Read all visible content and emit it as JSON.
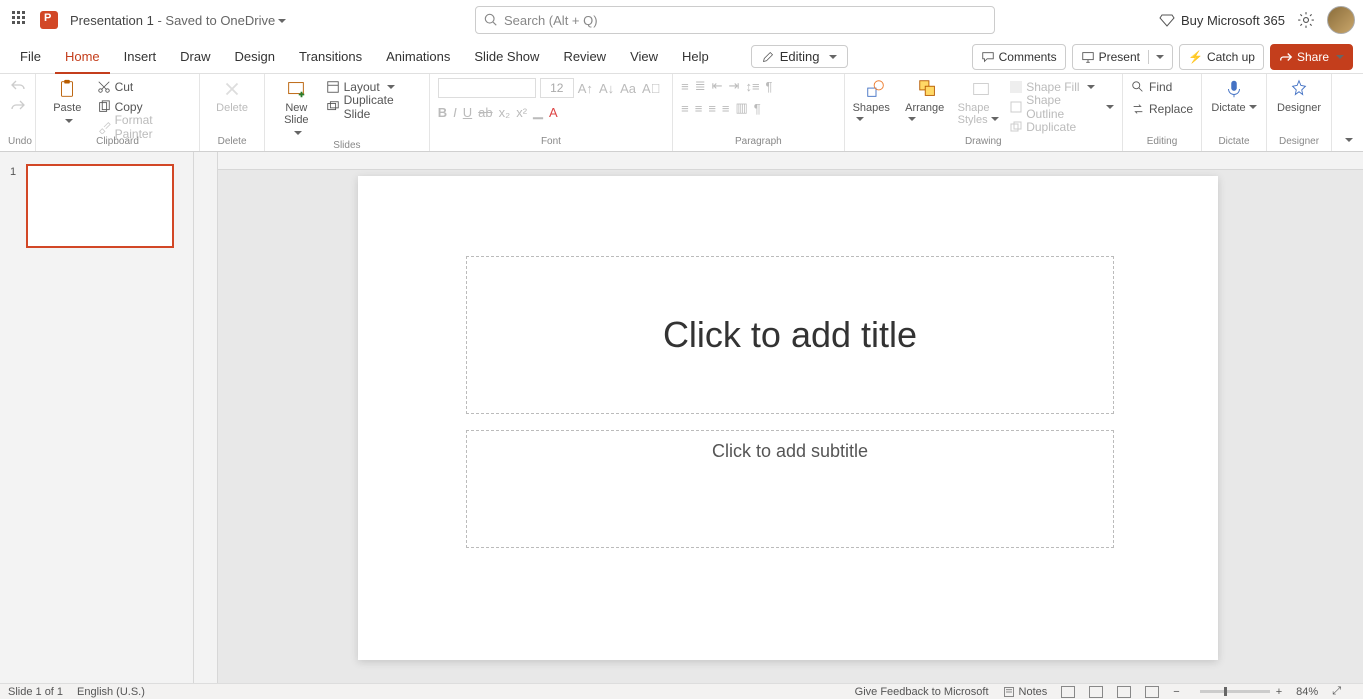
{
  "titlebar": {
    "doc_name": "Presentation 1",
    "saved_text": " - Saved to OneDrive",
    "search_placeholder": "Search (Alt + Q)",
    "buy_label": "Buy Microsoft 365"
  },
  "tabs": {
    "file": "File",
    "home": "Home",
    "insert": "Insert",
    "draw": "Draw",
    "design": "Design",
    "transitions": "Transitions",
    "animations": "Animations",
    "slideshow": "Slide Show",
    "review": "Review",
    "view": "View",
    "help": "Help",
    "editing": "Editing",
    "comments": "Comments",
    "present": "Present",
    "catchup": "Catch up",
    "share": "Share"
  },
  "ribbon": {
    "undo_group": "Undo",
    "paste": "Paste",
    "cut": "Cut",
    "copy": "Copy",
    "format_painter": "Format Painter",
    "clipboard_group": "Clipboard",
    "delete": "Delete",
    "delete_group": "Delete",
    "new_slide": "New Slide",
    "layout": "Layout",
    "duplicate_slide": "Duplicate Slide",
    "slides_group": "Slides",
    "font_size": "12",
    "font_group": "Font",
    "paragraph_group": "Paragraph",
    "shapes": "Shapes",
    "arrange": "Arrange",
    "shape_styles": "Shape Styles",
    "shape_fill": "Shape Fill",
    "shape_outline": "Shape Outline",
    "duplicate": "Duplicate",
    "drawing_group": "Drawing",
    "find": "Find",
    "replace": "Replace",
    "editing_group": "Editing",
    "dictate": "Dictate",
    "dictate_group": "Dictate",
    "designer": "Designer",
    "designer_group": "Designer"
  },
  "slide": {
    "number": "1",
    "title_ph": "Click to add title",
    "subtitle_ph": "Click to add subtitle"
  },
  "statusbar": {
    "slide_count": "Slide 1 of 1",
    "language": "English (U.S.)",
    "feedback": "Give Feedback to Microsoft",
    "notes": "Notes",
    "zoom": "84%"
  }
}
